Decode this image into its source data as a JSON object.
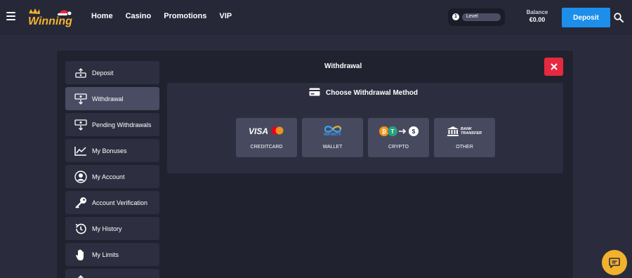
{
  "header": {
    "nav": [
      "Home",
      "Casino",
      "Promotions",
      "VIP"
    ],
    "level_number": "1",
    "level_label": "Level",
    "balance_label": "Balance",
    "balance_amount": "€0.00",
    "deposit_label": "Deposit"
  },
  "modal": {
    "title": "Withdrawal",
    "sidebar": [
      {
        "label": "Deposit",
        "icon": "deposit-icon"
      },
      {
        "label": "Withdrawal",
        "icon": "withdrawal-icon",
        "active": true
      },
      {
        "label": "Pending Withdrawals",
        "icon": "pending-withdrawals-icon"
      },
      {
        "label": "My Bonuses",
        "icon": "chart-icon"
      },
      {
        "label": "My Account",
        "icon": "user-icon"
      },
      {
        "label": "Account Verification",
        "icon": "key-icon"
      },
      {
        "label": "My History",
        "icon": "history-icon"
      },
      {
        "label": "My Limits",
        "icon": "hand-icon"
      }
    ],
    "method_title": "Choose Withdrawal Method",
    "methods": [
      {
        "label": "CREDITCARD",
        "logo_text": "VISA"
      },
      {
        "label": "WALLET",
        "logo_text": "INFINITY"
      },
      {
        "label": "CRYPTO"
      },
      {
        "label": "OTHER",
        "logo_text_1": "BANK",
        "logo_text_2": "TRANSFER"
      }
    ]
  },
  "colors": {
    "accent": "#1d8eea",
    "close": "#e5293f",
    "chat": "#f3b22d",
    "background": "#2a2c3d"
  }
}
